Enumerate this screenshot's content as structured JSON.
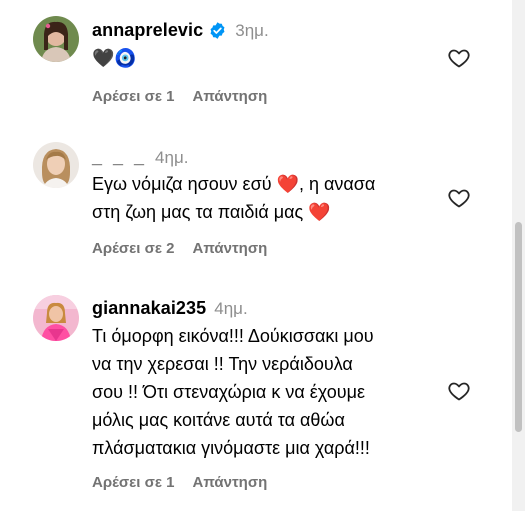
{
  "colors": {
    "username": "#000000",
    "timestamp": "#8e8e8e",
    "action_text": "#737373",
    "verified_badge": "#0095f6",
    "heart_outline": "#262626",
    "scrollbar_thumb": "#c1c1c1"
  },
  "comments": [
    {
      "username": "annaprelevic",
      "verified": true,
      "time": "3ημ.",
      "text": "🖤🧿",
      "likes_label": "Αρέσει σε 1",
      "reply_label": "Απάντηση",
      "icon": "heart-outline-icon"
    },
    {
      "username": "_ _ _",
      "verified": false,
      "time": "4ημ.",
      "text_line1": "Εγω νόμιζα ησουν εσύ ❤️, η ανασα",
      "text_line2": "στη ζωη μας τα παιδιά μας ❤️",
      "likes_label": "Αρέσει σε 2",
      "reply_label": "Απάντηση",
      "icon": "heart-outline-icon"
    },
    {
      "username": "giannakai235",
      "verified": false,
      "time": "4ημ.",
      "text_lines": [
        "Τι όμορφη εικόνα!!! Δούκισσακι μου",
        "να την χερεσαι !! Την νεράιδουλα",
        "σου !! Ότι στεναχώρια κ να έχουμε",
        "μόλις μας κοιτάνε αυτά τα αθώα",
        "πλάσματακια γινόμαστε μια χαρά!!!"
      ],
      "likes_label": "Αρέσει σε 1",
      "reply_label": "Απάντηση",
      "icon": "heart-outline-icon"
    }
  ]
}
